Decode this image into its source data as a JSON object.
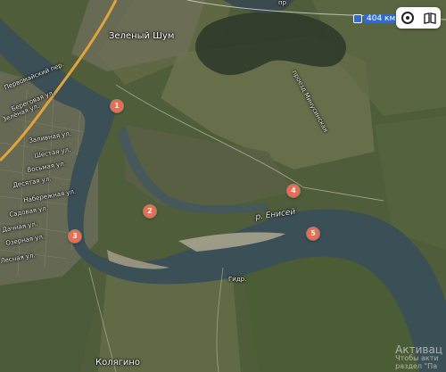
{
  "map": {
    "places": {
      "zeleny_shum": "Зеленый Шум",
      "kolyagino": "Колягино"
    },
    "streets": {
      "top_right": "пр",
      "lane_minusinskaya": "проезд Минусинская",
      "left_1": "Первомайский пер.",
      "left_2": "Береговая ул.",
      "left_3": "Заливная ул.",
      "left_4": "Шестая ул.",
      "left_5": "Восьмая ул.",
      "left_6": "Десятая ул.",
      "left_7": "Набережная ул.",
      "left_8": "Садовая ул.",
      "left_9": "Дачная ул.",
      "left_10": "Озерная ул.",
      "left_11": "Лесная ул.",
      "left_12": "Зелёная ул."
    },
    "river": "р. Енисей",
    "km_marker": "404 км",
    "small_label": "Гидр.",
    "markers": [
      "1",
      "2",
      "3",
      "4",
      "5"
    ]
  },
  "controls": {
    "layers_icon": "circle-layers-icon",
    "book_icon": "book-icon"
  },
  "watermark": {
    "title": "Активац",
    "line1": "Чтобы акти",
    "line2": "раздел \"Па"
  },
  "colors": {
    "river": "#3b4f56",
    "marker": "#ef6b4d",
    "km_badge": "#2f6bd8",
    "highway": "#e0a43b"
  }
}
